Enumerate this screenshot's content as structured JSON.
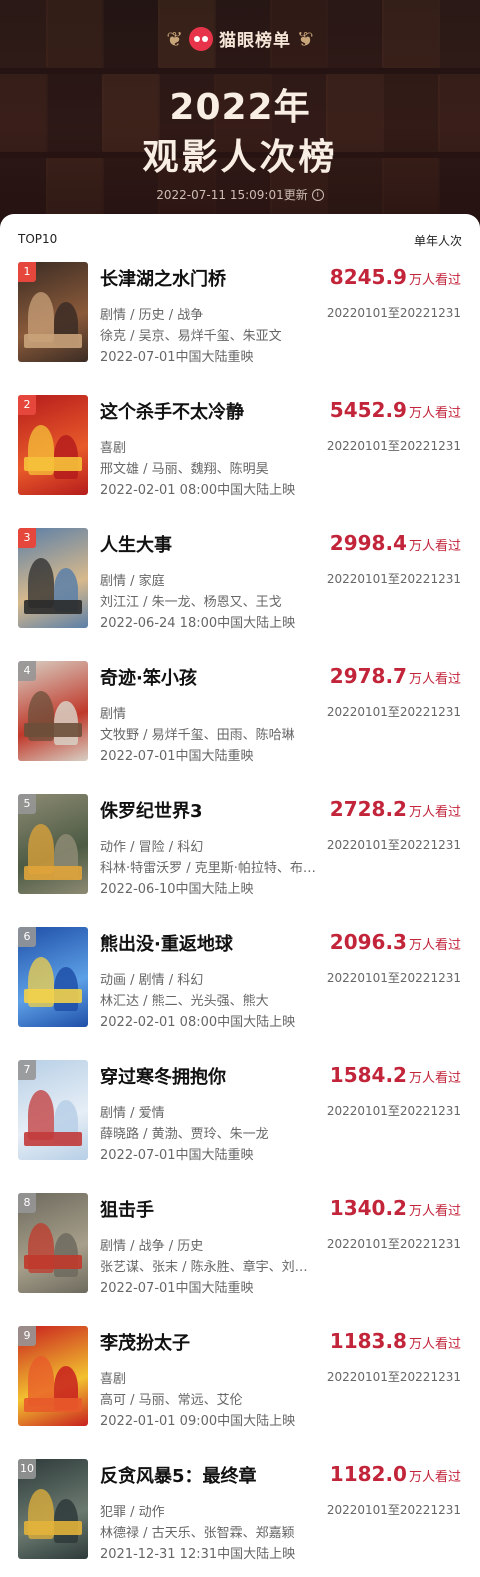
{
  "header": {
    "brand_name": "猫眼榜单",
    "title_year": "2022年",
    "title_main": "观影人次榜",
    "update_time": "2022-07-11 15:09:01更新"
  },
  "list": {
    "left_label": "TOP10",
    "right_label": "单年人次",
    "unit": "万人看过",
    "movies": [
      {
        "rank": "1",
        "name": "长津湖之水门桥",
        "score": "8245.9",
        "genre": "剧情 / 历史 / 战争",
        "period": "20220101至20221231",
        "cast": "徐克 / 吴京、易烊千玺、朱亚文",
        "release": "2022-07-01中国大陆重映",
        "poster_colors": [
          "#3b2c24",
          "#8a5a3a",
          "#c9a27a"
        ]
      },
      {
        "rank": "2",
        "name": "这个杀手不太冷静",
        "score": "5452.9",
        "genre": "喜剧",
        "period": "20220101至20221231",
        "cast": "邢文雄 / 马丽、魏翔、陈明昊",
        "release": "2022-02-01 08:00中国大陆上映",
        "poster_colors": [
          "#b51c1c",
          "#e85a2a",
          "#f6c23a"
        ]
      },
      {
        "rank": "3",
        "name": "人生大事",
        "score": "2998.4",
        "genre": "剧情 / 家庭",
        "period": "20220101至20221231",
        "cast": "刘江江 / 朱一龙、杨恩又、王戈",
        "release": "2022-06-24 18:00中国大陆上映",
        "poster_colors": [
          "#5b7fa8",
          "#d7b98c",
          "#2b2b2b"
        ]
      },
      {
        "rank": "4",
        "name": "奇迹·笨小孩",
        "score": "2978.7",
        "genre": "剧情",
        "period": "20220101至20221231",
        "cast": "文牧野 / 易烊千玺、田雨、陈哈琳",
        "release": "2022-07-01中国大陆重映",
        "poster_colors": [
          "#d8d0c4",
          "#c0392b",
          "#6b4f3a"
        ]
      },
      {
        "rank": "5",
        "name": "侏罗纪世界3",
        "score": "2728.2",
        "genre": "动作 / 冒险 / 科幻",
        "period": "20220101至20221231",
        "cast": "科林·特雷沃罗 / 克里斯·帕拉特、布莱丝·达拉斯·霍华德",
        "release": "2022-06-10中国大陆上映",
        "poster_colors": [
          "#8d8a73",
          "#4d5b44",
          "#e0a43a"
        ]
      },
      {
        "rank": "6",
        "name": "熊出没·重返地球",
        "score": "2096.3",
        "genre": "动画 / 剧情 / 科幻",
        "period": "20220101至20221231",
        "cast": "林汇达 / 熊二、光头强、熊大",
        "release": "2022-02-01 08:00中国大陆上映",
        "poster_colors": [
          "#1f4fa8",
          "#5da0e6",
          "#f2d04a"
        ]
      },
      {
        "rank": "7",
        "name": "穿过寒冬拥抱你",
        "score": "1584.2",
        "genre": "剧情 / 爱情",
        "period": "20220101至20221231",
        "cast": "薛晓路 / 黄渤、贾玲、朱一龙",
        "release": "2022-07-01中国大陆重映",
        "poster_colors": [
          "#b7cfe6",
          "#e6eef6",
          "#c23a3a"
        ]
      },
      {
        "rank": "8",
        "name": "狙击手",
        "score": "1340.2",
        "genre": "剧情 / 战争 / 历史",
        "period": "20220101至20221231",
        "cast": "张艺谋、张末 / 陈永胜、章宇、刘奕铁",
        "release": "2022-07-01中国大陆重映",
        "poster_colors": [
          "#6d6a5e",
          "#a79f8a",
          "#c0392b"
        ]
      },
      {
        "rank": "9",
        "name": "李茂扮太子",
        "score": "1183.8",
        "genre": "喜剧",
        "period": "20220101至20221231",
        "cast": "高可 / 马丽、常远、艾伦",
        "release": "2022-01-01 09:00中国大陆上映",
        "poster_colors": [
          "#c8201f",
          "#f2c230",
          "#e85a2a"
        ]
      },
      {
        "rank": "10",
        "name": "反贪风暴5：最终章",
        "score": "1182.0",
        "genre": "犯罪 / 动作",
        "period": "20220101至20221231",
        "cast": "林德禄 / 古天乐、张智霖、郑嘉颖",
        "release": "2021-12-31 12:31中国大陆上映",
        "poster_colors": [
          "#2d3a3a",
          "#6b7a70",
          "#e3b23a"
        ]
      }
    ]
  }
}
